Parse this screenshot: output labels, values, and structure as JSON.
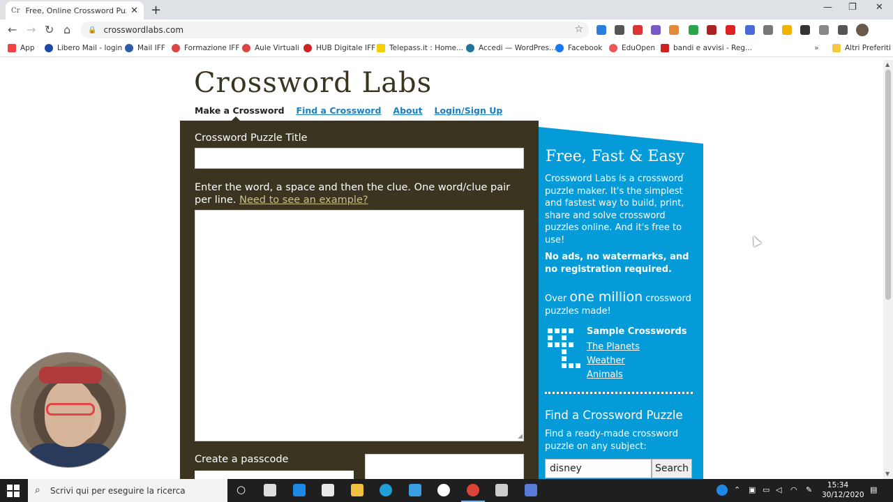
{
  "browser": {
    "tab_title": "Free, Online Crossword Puzzle M",
    "tab_favicon": "Cr",
    "url": "crosswordlabs.com",
    "bookmarks": [
      "App",
      "Libero Mail - login",
      "Mail IFF",
      "Formazione IFF",
      "Aule Virtuali",
      "HUB Digitale IFF",
      "Telepass.it : Home...",
      "Accedi — WordPres...",
      "Facebook",
      "EduOpen",
      "bandi e avvisi - Reg..."
    ],
    "bookmarks_more": "»",
    "other_bookmarks": "Altri Preferiti"
  },
  "site": {
    "logo": "Crossword Labs",
    "nav": {
      "make": "Make a Crossword",
      "find": "Find a Crossword",
      "about": "About",
      "login": "Login/Sign Up"
    },
    "form": {
      "title_label": "Crossword Puzzle Title",
      "title_value": "",
      "instructions": "Enter the word, a space and then the clue. One word/clue pair per line.",
      "example_link": "Need to see an example?",
      "words_value": "",
      "passcode_label": "Create a passcode"
    },
    "sidebar": {
      "title": "Free, Fast & Easy",
      "intro": "Crossword Labs is a crossword puzzle maker. It's the simplest and fastest way to build, print, share and solve crossword puzzles online. And it's free to use!",
      "no_ads": "No ads, no watermarks, and no registration required.",
      "over": "Over",
      "million": "one million",
      "count_rest": "crossword puzzles made!",
      "samples_title": "Sample Crosswords",
      "samples": [
        "The Planets",
        "Weather",
        "Animals"
      ],
      "find_title": "Find a Crossword Puzzle",
      "find_text": "Find a ready-made crossword puzzle on any subject:",
      "search_value": "disney",
      "search_button": "Search"
    }
  },
  "taskbar": {
    "search_placeholder": "Scrivi qui per eseguire la ricerca",
    "time": "15:34",
    "date": "30/12/2020"
  },
  "colors": {
    "panel_dark": "#3a3420",
    "panel_blue": "#049bd8",
    "link_blue": "#1a7fc4"
  }
}
